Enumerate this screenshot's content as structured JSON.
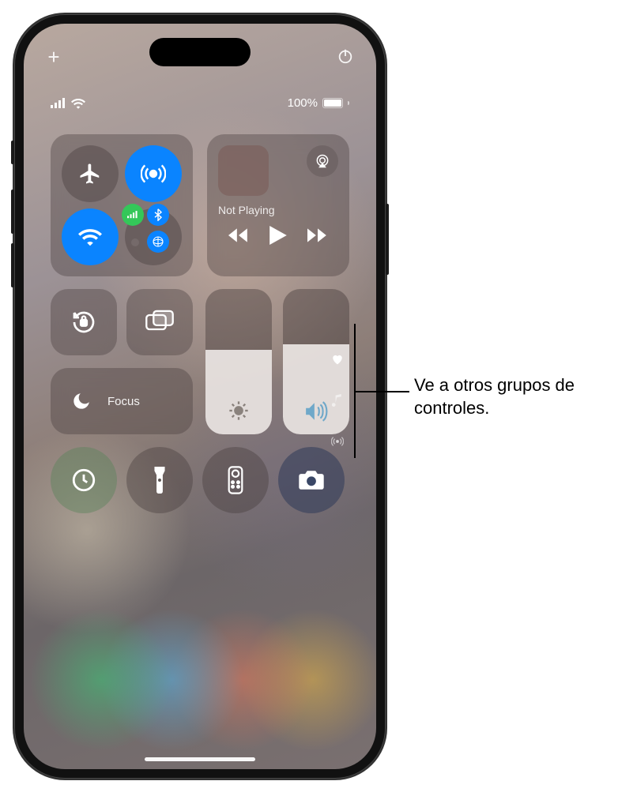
{
  "top": {
    "add": "+",
    "power": "power-icon"
  },
  "status": {
    "battery_label": "100%"
  },
  "connectivity": {
    "airplane": "airplane-icon",
    "airdrop": "airdrop-icon",
    "wifi": "wifi-icon",
    "group": "cellular-bluetooth-satellite"
  },
  "media": {
    "title": "Not Playing",
    "prev": "rewind-icon",
    "play": "play-icon",
    "next": "forward-icon",
    "airplay": "airplay-icon"
  },
  "orientation_lock": "orientation-lock-icon",
  "screen_mirroring": "screen-mirroring-icon",
  "focus": {
    "label": "Focus"
  },
  "brightness": {
    "icon": "sun-icon"
  },
  "volume": {
    "icon": "speaker-icon"
  },
  "bottom": {
    "timer": "timer-icon",
    "flashlight": "flashlight-icon",
    "remote": "remote-icon",
    "camera": "camera-icon"
  },
  "pages": {
    "favorites": "heart-icon",
    "music": "music-note-icon",
    "connectivity": "antenna-icon"
  },
  "callout": {
    "text": "Ve a otros grupos de controles."
  }
}
